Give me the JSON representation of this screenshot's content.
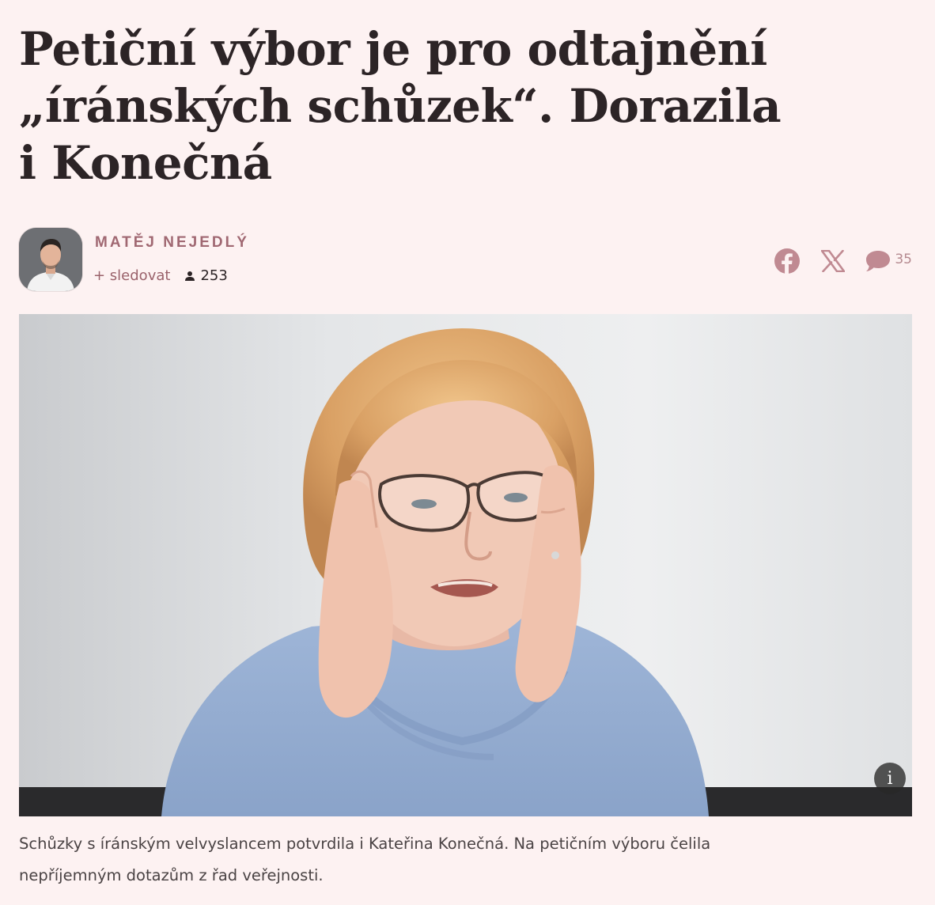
{
  "article": {
    "headline": "Petiční výbor je pro odtajnění „íránských schůzek“. Dorazila i Konečná",
    "author": {
      "name": "MATĚJ NEJEDLÝ",
      "follow_label": "+ sledovat",
      "followers": "253"
    },
    "share": {
      "facebook_icon": "facebook-icon",
      "x_icon": "x-icon",
      "comment_icon": "comment-icon",
      "comment_count": "35"
    },
    "photo": {
      "info_label": "i"
    },
    "caption": "Schůzky s íránským velvyslancem potvrdila i Kateřina Konečná. Na petičním výboru čelila nepříjemným dotazům z řad veřejnosti."
  },
  "colors": {
    "background": "#fdf2f2",
    "headline": "#2c2426",
    "accent": "#a06872",
    "share_icon": "#c08a92"
  }
}
